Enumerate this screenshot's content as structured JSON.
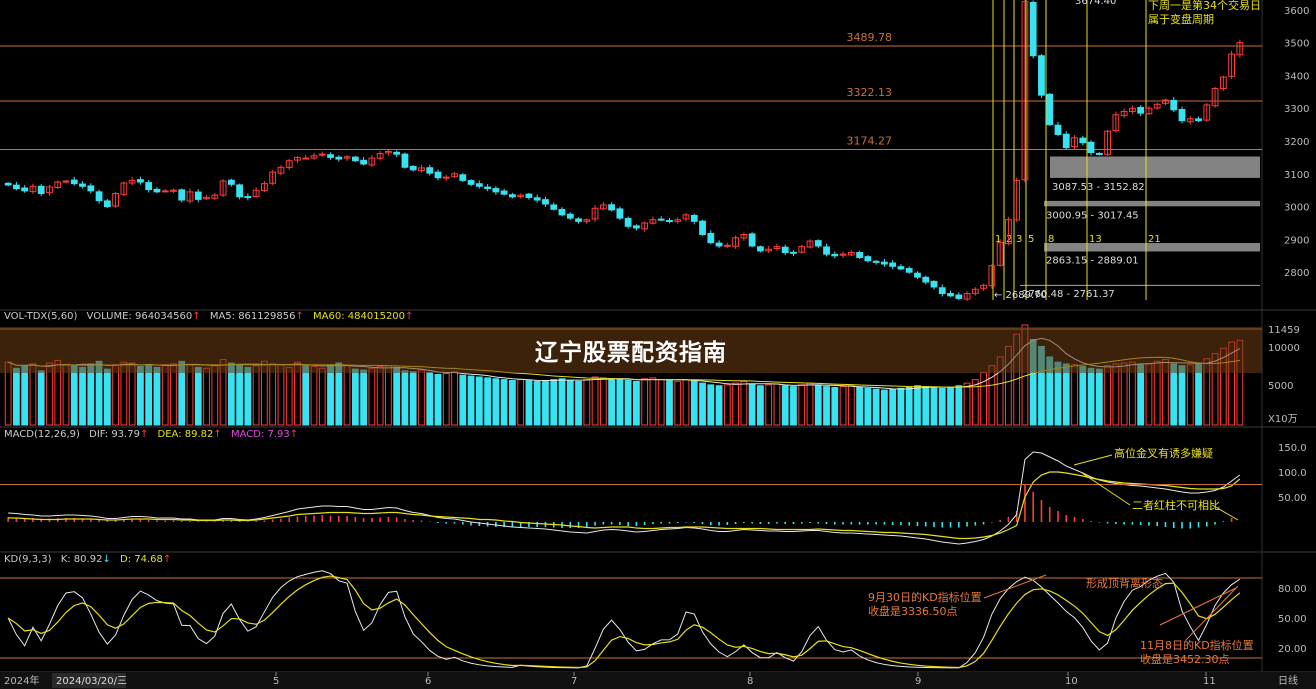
{
  "banner": {
    "title": "辽宁股票配资指南"
  },
  "colors": {
    "up": "#ff3b3b",
    "down": "#39e2f0",
    "level": "#c8703a",
    "yellow": "#e6e01a",
    "dif": "#e8e8e8",
    "dea": "#e6e01a",
    "macd": "#e04ae0"
  },
  "volume_panel": {
    "label": "VOL-TDX(5,60)",
    "volume": "VOLUME: 964034560",
    "ma5": "MA5: 861129856",
    "ma60": "MA60: 484015200",
    "unit": "X10万"
  },
  "macd_panel": {
    "label": "MACD(12,26,9)",
    "dif": "DIF: 93.79",
    "dea": "DEA: 89.82",
    "macd": "MACD: 7.93"
  },
  "kd_panel": {
    "label": "KD(9,3,3)",
    "k": "K: 80.92",
    "d": "D: 74.68"
  },
  "bottom_axis": {
    "year": "2024年",
    "cursor_date": "2024/03/20/三",
    "period": "日线"
  },
  "annotations": {
    "top_note_1": "下周一是第34个交易日",
    "top_note_2": "属于变盘周期",
    "top_price": "3674.40",
    "low_price": "2689.70",
    "macd_note_1": "高位金叉有诱多嫌疑",
    "macd_note_2": "二者红柱不可相比",
    "kd_note_top": "形成顶背离形态",
    "kd_note_left_1": "9月30日的KD指标位置",
    "kd_note_left_2": "收盘是3336.50点",
    "kd_note_right_1": "11月8日的KD指标位置",
    "kd_note_right_2": "收盘是3452.30点"
  },
  "chart_data": {
    "type": "candlestick",
    "price_axis": {
      "ylim": [
        2700,
        3630
      ],
      "ticks": [
        2800,
        2900,
        3000,
        3100,
        3200,
        3300,
        3400,
        3500,
        3600
      ]
    },
    "price_levels": [
      {
        "label": "3489.78",
        "value": 3489.78
      },
      {
        "label": "3322.13",
        "value": 3322.13
      },
      {
        "label": "3174.27",
        "value": 3174.27
      }
    ],
    "gap_zones": [
      {
        "label": "3087.53 - 3152.82",
        "low": 3087.53,
        "high": 3152.82
      },
      {
        "label": "3000.95 - 3017.45",
        "low": 3000.95,
        "high": 3017.45
      },
      {
        "label": "2863.15 - 2889.01",
        "low": 2863.15,
        "high": 2889.01
      },
      {
        "label": "2760.48 - 2761.37",
        "low": 2760.48,
        "high": 2761.37
      }
    ],
    "fib_counts": [
      "1",
      "2",
      "3",
      "5",
      "8",
      "13",
      "21"
    ],
    "month_ticks": [
      "5",
      "6",
      "7",
      "8",
      "9",
      "10",
      "11"
    ],
    "volume_axis": {
      "ticks": [
        "11459",
        "10000",
        "5000"
      ]
    },
    "macd_axis": {
      "ticks": [
        "150.0",
        "100.0",
        "50.00"
      ]
    },
    "kd_axis": {
      "ticks": [
        "80.00",
        "50.00",
        "20.00"
      ]
    },
    "closes": [
      3066,
      3055,
      3048,
      3062,
      3040,
      3060,
      3075,
      3078,
      3070,
      3062,
      3048,
      3018,
      3000,
      3040,
      3072,
      3080,
      3075,
      3052,
      3045,
      3048,
      3050,
      3020,
      3045,
      3022,
      3028,
      3035,
      3078,
      3068,
      3030,
      3028,
      3050,
      3070,
      3105,
      3120,
      3140,
      3150,
      3148,
      3155,
      3160,
      3150,
      3145,
      3152,
      3140,
      3130,
      3148,
      3162,
      3168,
      3160,
      3120,
      3112,
      3118,
      3102,
      3088,
      3090,
      3100,
      3080,
      3068,
      3062,
      3055,
      3045,
      3038,
      3030,
      3035,
      3028,
      3020,
      3008,
      2992,
      2975,
      2965,
      2955,
      2960,
      2995,
      3005,
      2990,
      2965,
      2940,
      2935,
      2950,
      2960,
      2960,
      2955,
      2960,
      2975,
      2955,
      2915,
      2890,
      2880,
      2882,
      2905,
      2915,
      2880,
      2865,
      2870,
      2878,
      2860,
      2858,
      2878,
      2895,
      2880,
      2855,
      2850,
      2855,
      2860,
      2845,
      2835,
      2830,
      2825,
      2818,
      2810,
      2800,
      2785,
      2770,
      2755,
      2735,
      2728,
      2720,
      2735,
      2748,
      2760,
      2820,
      2890,
      2960,
      3080,
      3625,
      3460,
      3340,
      3250,
      3220,
      3180,
      3210,
      3195,
      3165,
      3160,
      3230,
      3280,
      3290,
      3300,
      3285,
      3300,
      3312,
      3325,
      3295,
      3262,
      3268,
      3262,
      3310,
      3360,
      3395,
      3465,
      3500
    ],
    "volumes": [
      7200,
      6500,
      6800,
      7000,
      6200,
      7100,
      7400,
      6900,
      6800,
      6600,
      7000,
      7300,
      6400,
      6900,
      7200,
      7100,
      6700,
      6800,
      6600,
      6900,
      7000,
      7300,
      6900,
      6600,
      6500,
      6800,
      7500,
      7100,
      6900,
      6600,
      6800,
      7300,
      7000,
      6900,
      6600,
      7200,
      6800,
      6700,
      6500,
      6900,
      7100,
      6800,
      6400,
      6300,
      6500,
      6700,
      6800,
      6600,
      6200,
      6100,
      6300,
      6000,
      5800,
      5900,
      6100,
      5700,
      5600,
      5500,
      5400,
      5300,
      5200,
      5100,
      5200,
      5100,
      5000,
      5100,
      5200,
      5300,
      5100,
      5000,
      5200,
      5500,
      5400,
      5300,
      5200,
      5100,
      5000,
      5300,
      5400,
      5200,
      5100,
      5000,
      5200,
      5100,
      4800,
      4600,
      4500,
      4600,
      4800,
      5000,
      4700,
      4500,
      4600,
      4700,
      4500,
      4400,
      4600,
      4800,
      4600,
      4400,
      4300,
      4400,
      4500,
      4300,
      4200,
      4100,
      4000,
      4100,
      4200,
      4300,
      4500,
      4400,
      4300,
      4200,
      4300,
      4500,
      4800,
      5200,
      6000,
      6800,
      7800,
      9000,
      10400,
      11459,
      9800,
      9000,
      7800,
      7200,
      7000,
      6900,
      6700,
      6500,
      6400,
      6800,
      7000,
      7100,
      7200,
      6900,
      7000,
      7300,
      7500,
      7000,
      6800,
      6900,
      7100,
      7600,
      8200,
      8800,
      9500,
      9700
    ],
    "macd_hist": [
      10,
      9,
      8,
      8,
      7,
      7,
      8,
      8,
      8,
      7,
      6,
      5,
      3,
      3,
      4,
      5,
      5,
      4,
      3,
      3,
      3,
      2,
      2,
      1,
      1,
      1,
      3,
      3,
      2,
      1,
      2,
      3,
      5,
      7,
      9,
      11,
      12,
      13,
      14,
      13,
      12,
      12,
      10,
      8,
      8,
      9,
      10,
      9,
      6,
      4,
      3,
      1,
      -2,
      -3,
      -3,
      -5,
      -7,
      -8,
      -9,
      -10,
      -10,
      -11,
      -10,
      -10,
      -10,
      -10,
      -11,
      -12,
      -12,
      -12,
      -11,
      -7,
      -5,
      -5,
      -6,
      -8,
      -8,
      -6,
      -4,
      -3,
      -3,
      -2,
      -1,
      -2,
      -4,
      -6,
      -7,
      -6,
      -4,
      -2,
      -3,
      -4,
      -4,
      -3,
      -4,
      -4,
      -3,
      -2,
      -3,
      -4,
      -5,
      -5,
      -5,
      -5,
      -5,
      -5,
      -5,
      -6,
      -6,
      -7,
      -8,
      -9,
      -10,
      -11,
      -11,
      -11,
      -9,
      -7,
      -5,
      -1,
      4,
      10,
      22,
      75,
      60,
      44,
      30,
      22,
      14,
      10,
      6,
      2,
      -1,
      -3,
      -4,
      -5,
      -5,
      -6,
      -7,
      -8,
      -10,
      -12,
      -13,
      -13,
      -11,
      -9,
      -5,
      2,
      8
    ],
    "dif": [
      18,
      17,
      15,
      14,
      12,
      12,
      13,
      14,
      14,
      13,
      12,
      10,
      7,
      7,
      9,
      11,
      11,
      10,
      8,
      8,
      8,
      6,
      6,
      4,
      4,
      4,
      7,
      7,
      5,
      4,
      6,
      9,
      13,
      17,
      21,
      26,
      28,
      30,
      32,
      32,
      31,
      31,
      28,
      25,
      25,
      27,
      29,
      28,
      23,
      19,
      17,
      13,
      9,
      7,
      6,
      3,
      0,
      -2,
      -4,
      -6,
      -8,
      -10,
      -11,
      -12,
      -13,
      -14,
      -16,
      -18,
      -20,
      -21,
      -22,
      -19,
      -16,
      -15,
      -16,
      -18,
      -20,
      -19,
      -17,
      -15,
      -14,
      -13,
      -11,
      -12,
      -14,
      -17,
      -19,
      -19,
      -17,
      -15,
      -16,
      -17,
      -18,
      -18,
      -19,
      -19,
      -18,
      -17,
      -17,
      -19,
      -21,
      -22,
      -22,
      -23,
      -24,
      -25,
      -26,
      -27,
      -28,
      -30,
      -32,
      -34,
      -37,
      -40,
      -42,
      -44,
      -42,
      -39,
      -35,
      -28,
      -18,
      -5,
      15,
      125,
      140,
      138,
      130,
      122,
      112,
      105,
      98,
      90,
      84,
      80,
      77,
      75,
      73,
      72,
      70,
      68,
      66,
      63,
      60,
      58,
      58,
      60,
      63,
      70,
      82,
      94
    ],
    "dea": [
      8,
      8,
      7,
      6,
      5,
      5,
      5,
      6,
      6,
      6,
      6,
      5,
      4,
      4,
      5,
      6,
      6,
      6,
      5,
      5,
      5,
      4,
      4,
      3,
      3,
      3,
      4,
      4,
      3,
      3,
      4,
      6,
      8,
      10,
      12,
      15,
      16,
      17,
      18,
      19,
      19,
      19,
      18,
      17,
      17,
      18,
      19,
      19,
      17,
      15,
      14,
      12,
      11,
      10,
      9,
      8,
      7,
      5,
      5,
      4,
      2,
      1,
      -1,
      -2,
      -3,
      -4,
      -5,
      -6,
      -8,
      -9,
      -11,
      -12,
      -11,
      -10,
      -10,
      -10,
      -12,
      -13,
      -13,
      -12,
      -11,
      -11,
      -10,
      -10,
      -10,
      -11,
      -12,
      -13,
      -13,
      -13,
      -13,
      -13,
      -14,
      -15,
      -15,
      -15,
      -15,
      -15,
      -14,
      -15,
      -16,
      -17,
      -17,
      -18,
      -19,
      -20,
      -21,
      -21,
      -22,
      -23,
      -24,
      -25,
      -27,
      -29,
      -31,
      -33,
      -33,
      -32,
      -30,
      -27,
      -22,
      -15,
      -7,
      50,
      80,
      94,
      100,
      100,
      98,
      95,
      92,
      88,
      85,
      82,
      80,
      78,
      77,
      76,
      75,
      74,
      73,
      71,
      69,
      67,
      66,
      66,
      66,
      67,
      72,
      86
    ]
  }
}
